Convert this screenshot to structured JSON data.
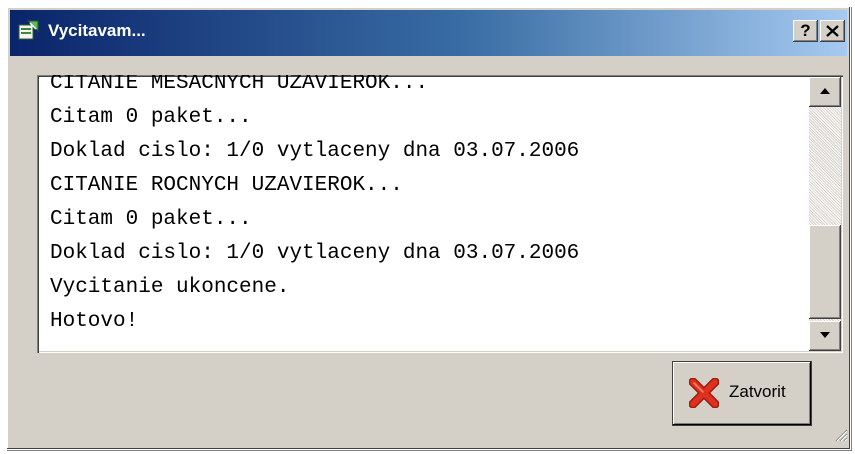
{
  "window": {
    "title": "Vycitavam...",
    "help_label": "?"
  },
  "log": {
    "lines": [
      "CITANIE MESACNYCH UZAVIEROK...",
      "Citam 0 paket...",
      "Doklad cislo: 1/0 vytlaceny dna 03.07.2006",
      "CITANIE ROCNYCH UZAVIEROK...",
      "Citam 0 paket...",
      "Doklad cislo: 1/0 vytlaceny dna 03.07.2006",
      "Vycitanie ukoncene.",
      "Hotovo!"
    ]
  },
  "actions": {
    "close_label": "Zatvorit"
  },
  "icons": {
    "app": "app-icon",
    "help": "help-icon",
    "close": "close-icon",
    "scroll_up": "arrow-up-icon",
    "scroll_down": "arrow-down-icon",
    "action_close": "red-x-icon",
    "resize": "size-grip-icon"
  },
  "colors": {
    "titlebar_start": "#0a246a",
    "titlebar_end": "#a6caf0",
    "face": "#d4d0c8",
    "x_icon": "#e0301e"
  }
}
